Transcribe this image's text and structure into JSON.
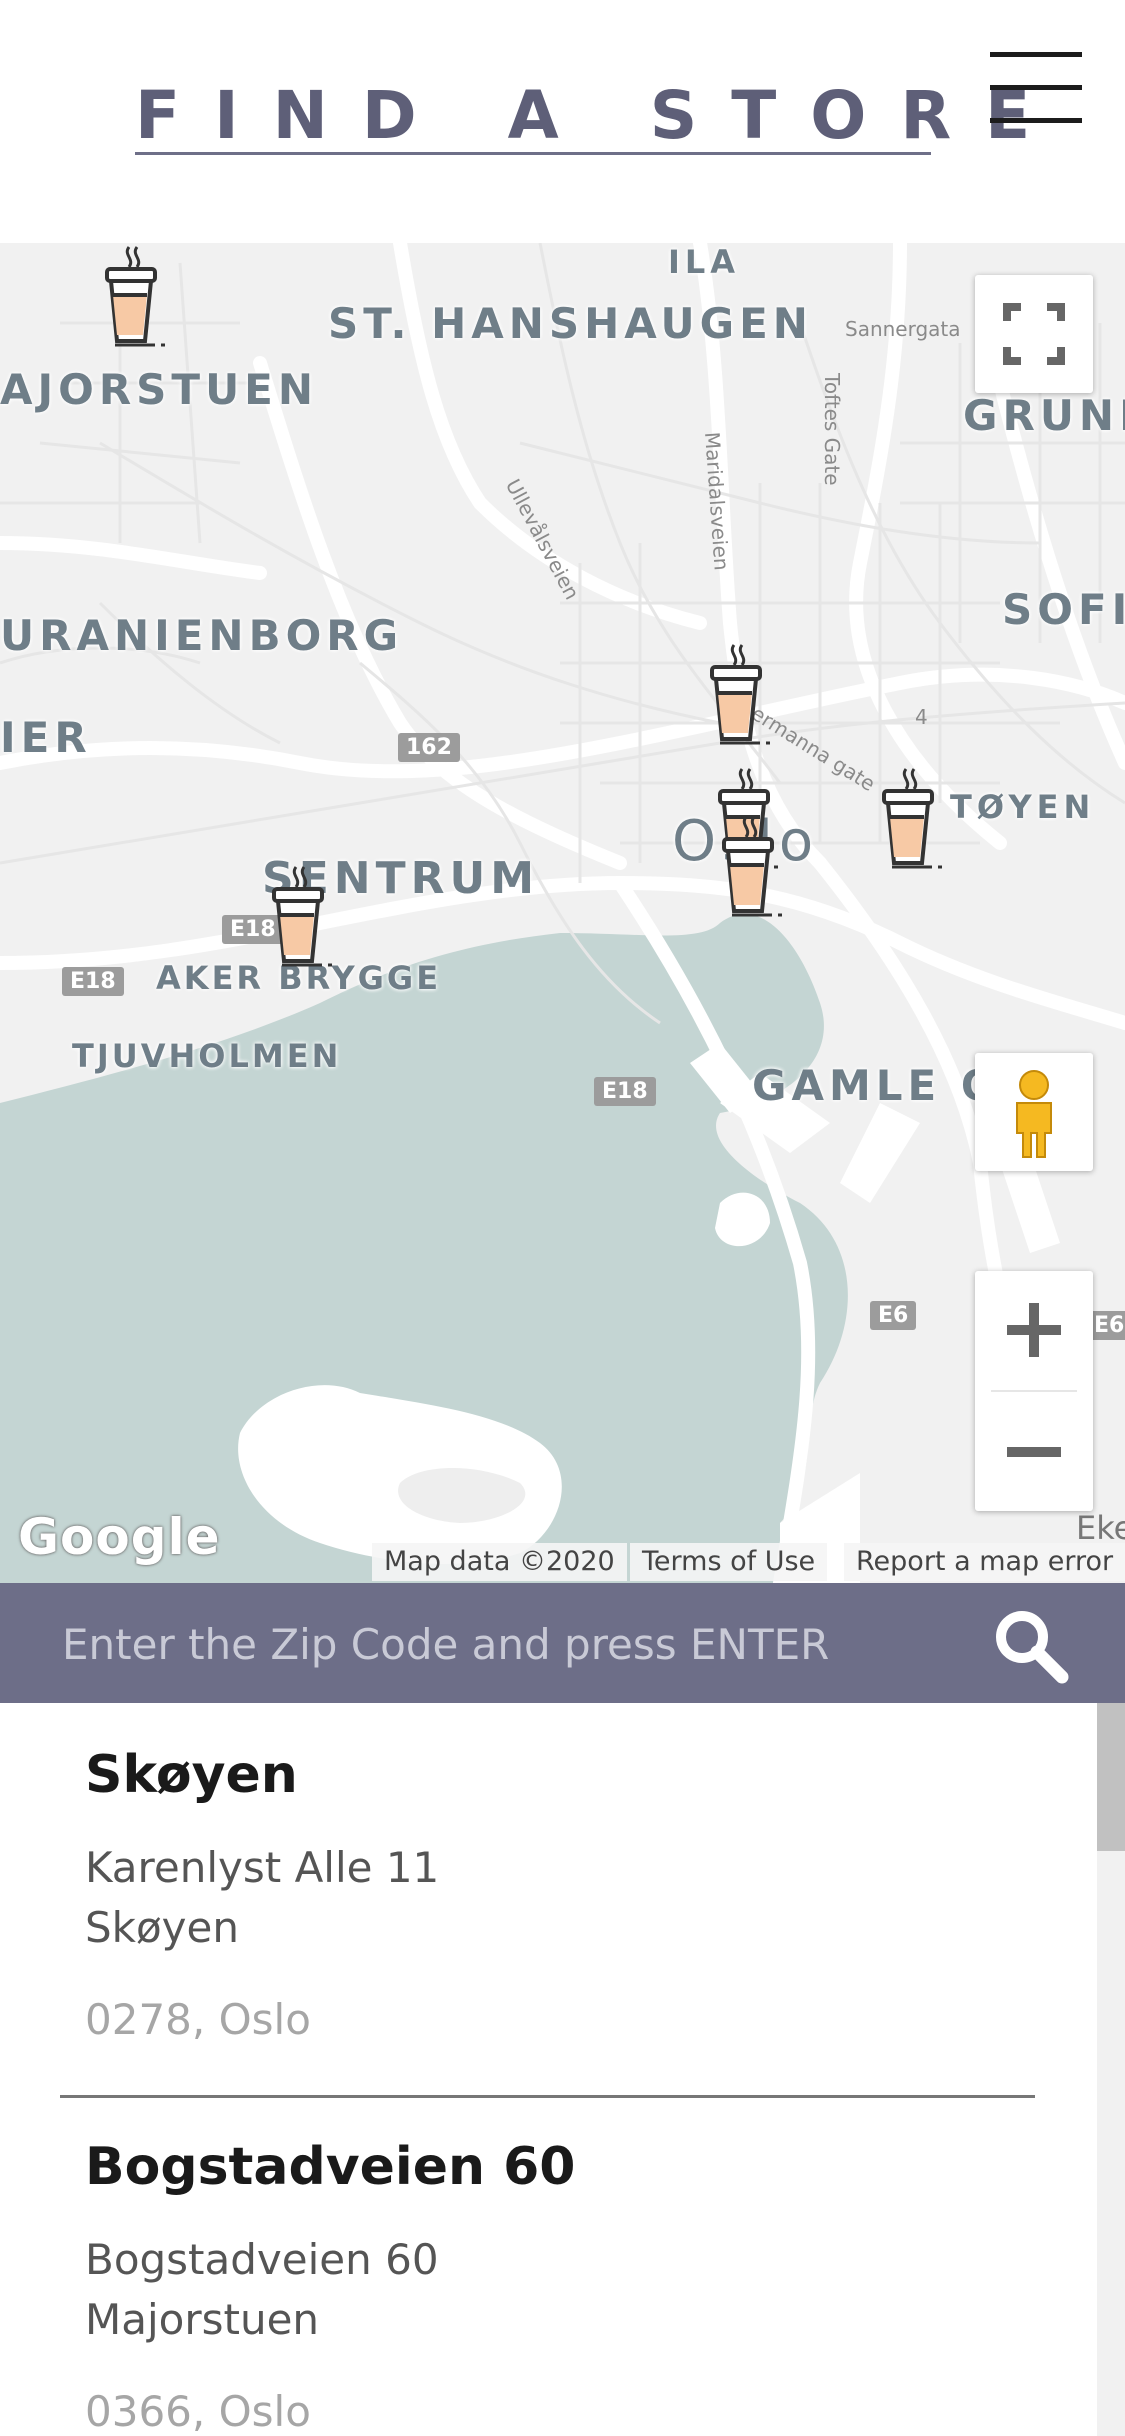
{
  "header": {
    "title": "FIND A STORE",
    "menu_icon": "hamburger-menu-icon"
  },
  "map": {
    "labels": {
      "ila": "ILA",
      "st_hanshaugen": "ST. HANSHAUGEN",
      "majorstuen": "AJORSTUEN",
      "grune": "GRUNE",
      "uranienborg": "URANIENBORG",
      "sofi": "SOFI",
      "ier": "IER",
      "sentrum": "SENTRUM",
      "toyen": "TØYEN",
      "oslo": "Oslo",
      "aker_brygge": "AKER BRYGGE",
      "tjuvholmen": "TJUVHOLMEN",
      "gamle": "GAMLE O"
    },
    "streets": {
      "sannergata": "Sannergata",
      "toftes_gate": "Toftes Gate",
      "ullevalsveien": "Ullevålsveien",
      "maridalsveien": "Maridalsveien",
      "hermanna_gate": "ermanna gate",
      "num_4": "4",
      "eke": "Eke"
    },
    "road_badges": {
      "r162": "162",
      "e18_a": "E18",
      "e18_b": "E18",
      "e18_c": "E18",
      "e6_a": "E6",
      "e6_b": "E6"
    },
    "marker_icon": "coffee-cup-icon",
    "fullscreen_icon": "fullscreen-icon",
    "pegman_icon": "pegman-icon",
    "zoom_in_icon": "plus-icon",
    "zoom_out_icon": "minus-icon",
    "google_logo": "Google",
    "map_data": "Map data ©2020",
    "terms": "Terms of Use",
    "report": "Report a map error",
    "colors": {
      "water": "#c4d5d3",
      "land": "#f1f1f1",
      "roads": "#ffffff"
    }
  },
  "search": {
    "placeholder": "Enter the Zip Code and press ENTER",
    "value": "",
    "icon": "search-icon"
  },
  "stores": [
    {
      "name": "Skøyen",
      "address": "Karenlyst Alle 11",
      "area": "Skøyen",
      "city": "0278, Oslo"
    },
    {
      "name": "Bogstadveien 60",
      "address": "Bogstadveien 60",
      "area": "Majorstuen",
      "city": "0366, Oslo"
    }
  ],
  "colors": {
    "brand": "#6d6e88",
    "title": "#5e5f78",
    "cup_fill": "#f7c9a5"
  }
}
